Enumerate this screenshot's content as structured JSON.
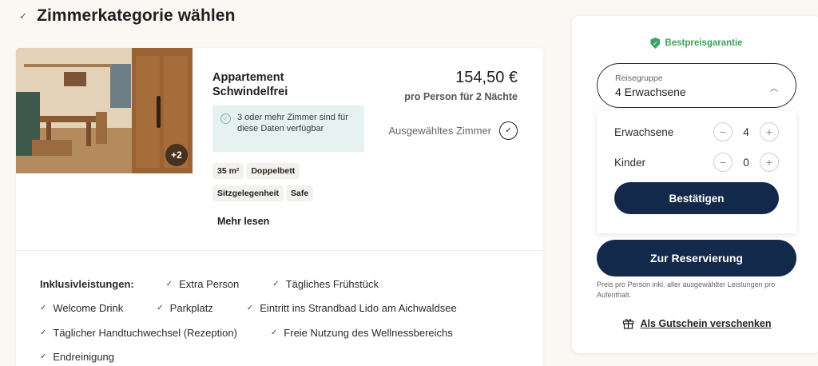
{
  "header": {
    "title": "Zimmerkategorie wählen"
  },
  "room": {
    "more_photos": "+2",
    "name": "Appartement Schwindelfrei",
    "availability": "3 oder mehr Zimmer sind für diese Daten verfügbar",
    "tags": [
      "35 m²",
      "Doppelbett",
      "Sitzgelegenheit",
      "Safe"
    ],
    "read_more": "Mehr lesen",
    "price": "154,50 €",
    "price_sub": "pro Person für 2 Nächte",
    "selected_label": "Ausgewähltes Zimmer"
  },
  "inclusives": {
    "label": "Inklusivleistungen:",
    "items": [
      "Extra Person",
      "Tägliches Frühstück",
      "Welcome Drink",
      "Parkplatz",
      "Eintritt ins Strandbad Lido am Aichwaldsee",
      "Täglicher Handtuchwechsel (Rezeption)",
      "Freie Nutzung des Wellnessbereichs",
      "Endreinigung"
    ]
  },
  "sidebar": {
    "guarantee": "Bestpreisgarantie",
    "group_label": "Reisegruppe",
    "group_value": "4 Erwachsene",
    "adults_label": "Erwachsene",
    "adults_value": "4",
    "children_label": "Kinder",
    "children_value": "0",
    "confirm": "Bestätigen",
    "reserve": "Zur Reservierung",
    "note": "Preis pro Person inkl. aller ausgewählter Leistungen pro Aufenthalt.",
    "gift": "Als Gutschein verschenken"
  },
  "colors": {
    "primary": "#13294b",
    "success": "#3aa35c",
    "bg": "#fbf7f3"
  }
}
